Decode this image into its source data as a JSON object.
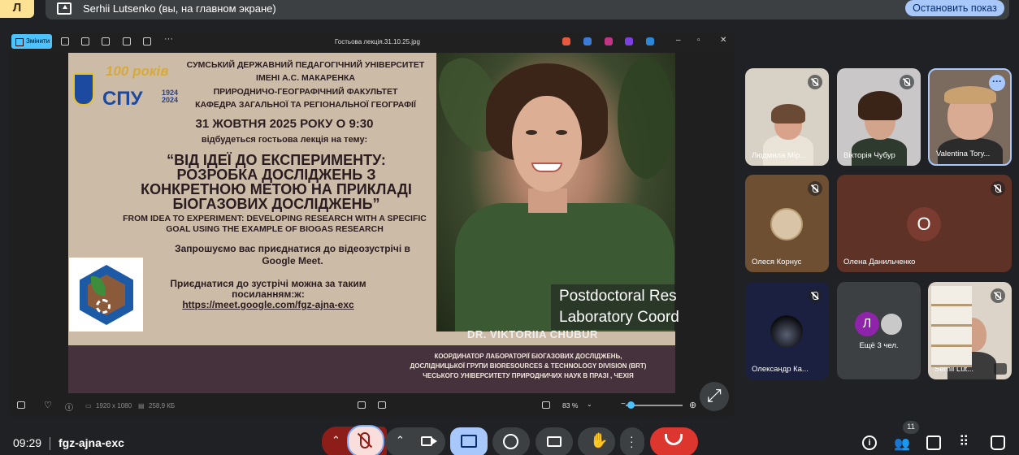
{
  "top": {
    "presenter_indicator": "Л",
    "presenting_text": "Serhii Lutsenko (вы, на главном экране)",
    "stop_button": "Остановить показ"
  },
  "viewer": {
    "edit_label": "Змінити",
    "file_name": "Гостьова лекція.31.10.25.jpg",
    "resolution": "1920 x 1080",
    "file_size": "258,9 КБ",
    "zoom": "83 %"
  },
  "poster": {
    "university_line1": "СУМСЬКИЙ ДЕРЖАВНИЙ ПЕДАГОГІЧНИЙ УНІВЕРСИТЕТ",
    "university_line2": "ІМЕНІ А.С. МАКАРЕНКА",
    "faculty": "ПРИРОДНИЧО-ГЕОГРАФІЧНИЙ ФАКУЛЬТЕТ",
    "department": "КАФЕДРА ЗАГАЛЬНОЇ ТА РЕГІОНАЛЬНОЇ ГЕОГРАФІЇ",
    "logo_100": "100 років",
    "logo_spu": "СПУ",
    "logo_years": "1924 2024",
    "date": "31 ЖОВТНЯ 2025 РОКУ О 9:30",
    "intro": "відбудеться гостьова лекція на тему:",
    "title_line1": "“ВІД ІДЕЇ ДО ЕКСПЕРИМЕНТУ:",
    "title_line2": "РОЗРОБКА ДОСЛІДЖЕНЬ З",
    "title_line3": "КОНКРЕТНОЮ МЕТОЮ НА ПРИКЛАДІ",
    "title_line4": "БІОГАЗОВИХ ДОСЛІДЖЕНЬ”",
    "english_line1": "FROM IDEA TO EXPERIMENT: DEVELOPING RESEARCH WITH A SPECIFIC",
    "english_line2": "GOAL USING THE EXAMPLE OF BIOGAS RESEARCH",
    "invite_line1": "Запрошуємо вас приєднатися до відеозустрічі в",
    "invite_line2": "Google Meet.",
    "join_line1": "Приєднатися до зустрічі можна за таким",
    "join_line2": "посиланням:ж:",
    "link": "https://meet.google.com/fgz-ajna-exc",
    "role_line1": "Postdoctoral Res",
    "role_line2": "Laboratory Coord",
    "speaker_name": "DR. VIKTORIIA CHUBUR",
    "bottom_line1": "КООРДИНАТОР ЛАБОРАТОРІЇ БІОГАЗОВИХ ДОСЛІДЖЕНЬ,",
    "bottom_line2": "ДОСЛІДНИЦЬКОЇ ГРУПИ BIORESOURCES & TECHNOLOGY DIVISION (BRT)",
    "bottom_line3": "ЧЕСЬКОГО УНІВЕРСИТЕТУ ПРИРОДНИЧИХ НАУК В ПРАЗІ , ЧЕХІЯ"
  },
  "participants": {
    "p1": "Людмила Мір...",
    "p2": "Вікторія Чубур",
    "p3": "Valentina Torу...",
    "p4": "Олеся Корнус",
    "p5": "Олена Данильченко",
    "p5_initial": "О",
    "p6": "Олександр Ка...",
    "more_initial": "Л",
    "more_text": "Ещё 3 чел.",
    "p8": "Serhii Lut..."
  },
  "bottom": {
    "time": "09:29",
    "meeting_code": "fgz-ajna-exc",
    "participant_count": "11"
  },
  "colors": {
    "accent": "#a8c7fa",
    "leave": "#dc362e",
    "presenter": "#fde293"
  }
}
